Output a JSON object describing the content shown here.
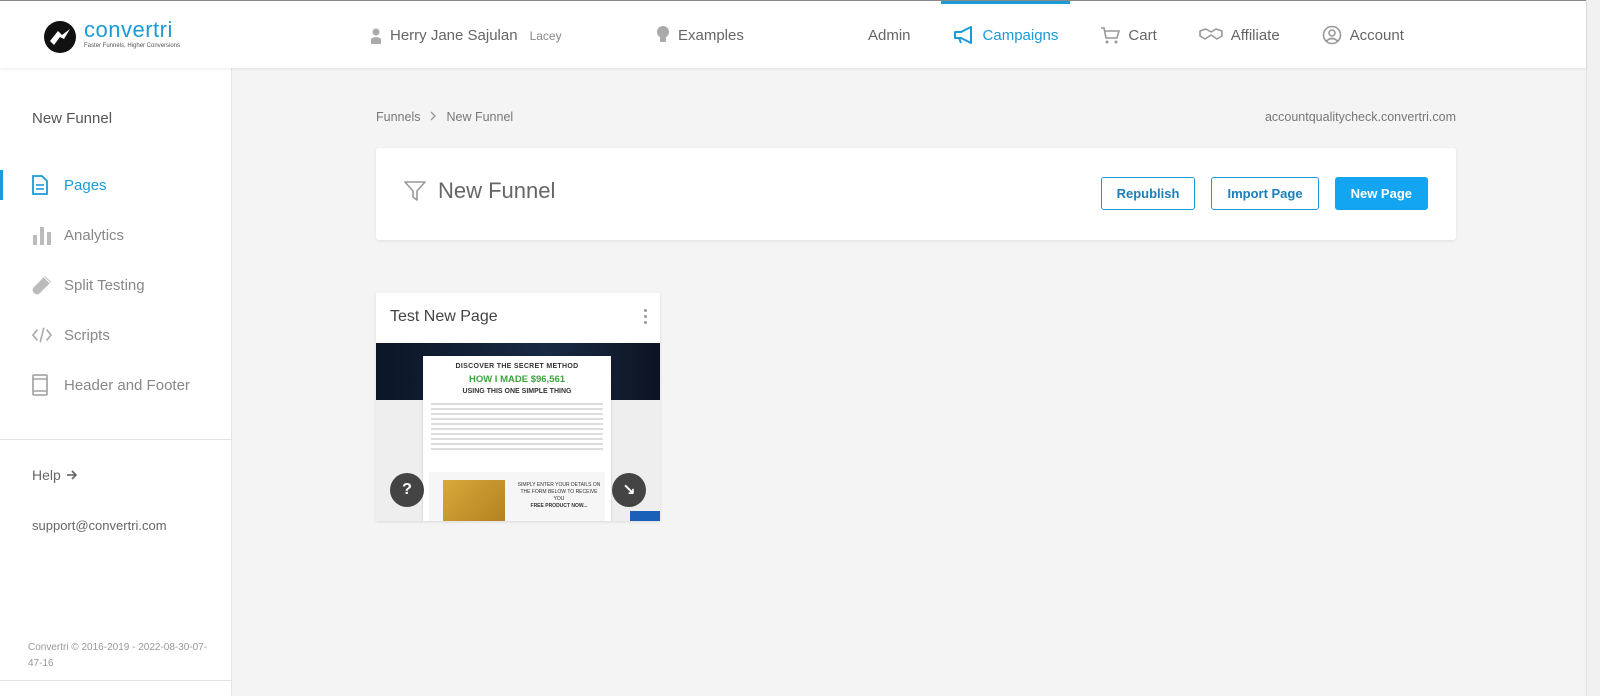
{
  "brand": {
    "name": "convertri",
    "tagline": "Faster Funnels, Higher Conversions"
  },
  "nav": {
    "user_name": "Herry Jane Sajulan",
    "user_sub": "Lacey",
    "examples": "Examples",
    "items": [
      {
        "label": "Admin",
        "icon": "none",
        "active": false
      },
      {
        "label": "Campaigns",
        "icon": "megaphone-icon",
        "active": true
      },
      {
        "label": "Cart",
        "icon": "cart-icon",
        "active": false
      },
      {
        "label": "Affiliate",
        "icon": "handshake-icon",
        "active": false
      },
      {
        "label": "Account",
        "icon": "user-circle-icon",
        "active": false
      }
    ]
  },
  "sidebar": {
    "title": "New Funnel",
    "items": [
      {
        "label": "Pages",
        "icon": "page-icon",
        "active": true
      },
      {
        "label": "Analytics",
        "icon": "bar-chart-icon",
        "active": false
      },
      {
        "label": "Split Testing",
        "icon": "test-tube-icon",
        "active": false
      },
      {
        "label": "Scripts",
        "icon": "code-icon",
        "active": false
      },
      {
        "label": "Header and Footer",
        "icon": "layout-icon",
        "active": false
      }
    ],
    "help": "Help",
    "support_email": "support@convertri.com",
    "copyright": "Convertri © 2016-2019 - 2022-08-30-07-47-16"
  },
  "breadcrumb": {
    "root": "Funnels",
    "current": "New Funnel"
  },
  "domain": "accountqualitycheck.convertri.com",
  "funnel": {
    "title": "New Funnel",
    "republish_label": "Republish",
    "import_label": "Import Page",
    "new_page_label": "New Page"
  },
  "page_card": {
    "title": "Test New Page",
    "preview": {
      "heading1": "DISCOVER THE SECRET METHOD",
      "heading2": "HOW I MADE $96,561",
      "heading3": "USING THIS ONE SIMPLE THING",
      "box_text": "SIMPLY ENTER YOUR DETAILS ON THE FORM BELOW TO RECEIVE YOU",
      "box_bold": "FREE PRODUCT NOW..."
    },
    "help_symbol": "?",
    "open_symbol": "↘"
  },
  "colors": {
    "accent": "#1a9bd8",
    "primary_button": "#13a5f2"
  }
}
